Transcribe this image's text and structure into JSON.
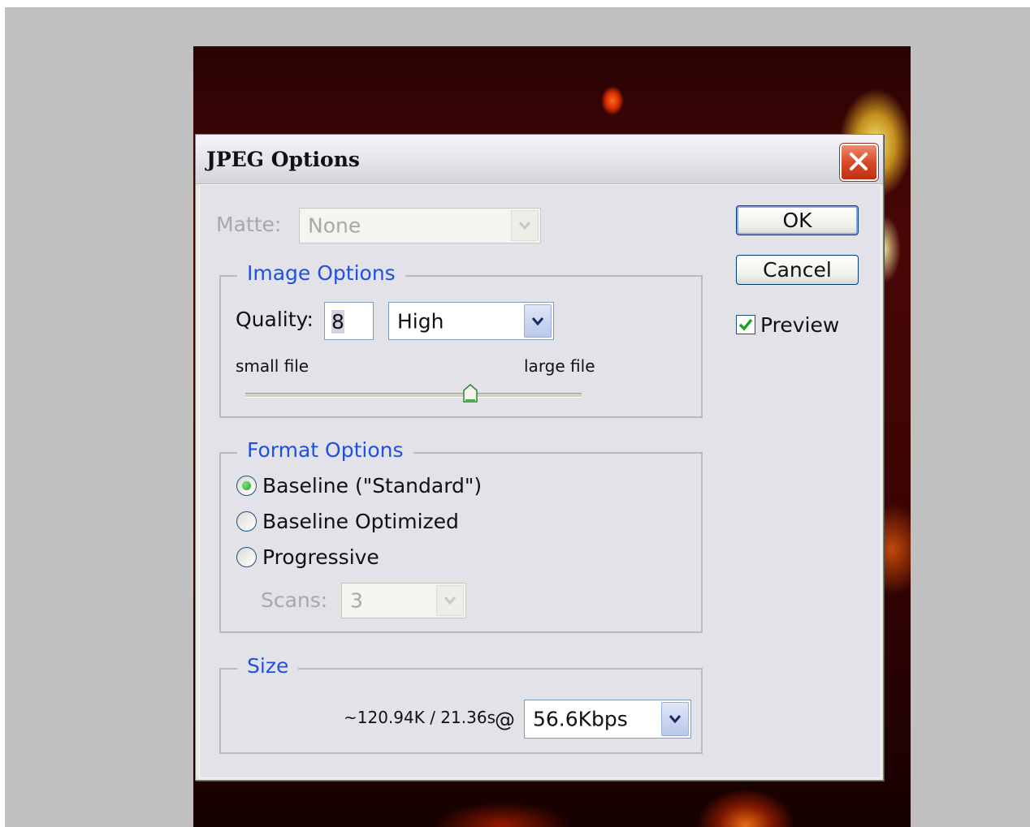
{
  "dialog": {
    "title": "JPEG Options",
    "close_label": "close"
  },
  "matte": {
    "label": "Matte:",
    "value": "None",
    "enabled": false
  },
  "image_options": {
    "title": "Image Options",
    "quality_label": "Quality:",
    "quality_value": "8",
    "quality_preset": "High",
    "small_label": "small file",
    "large_label": "large file",
    "slider_level": 0.67
  },
  "format_options": {
    "title": "Format Options",
    "options": [
      {
        "label": "Baseline (\"Standard\")",
        "selected": true
      },
      {
        "label": "Baseline Optimized",
        "selected": false
      },
      {
        "label": "Progressive",
        "selected": false
      }
    ],
    "scans_label": "Scans:",
    "scans_value": "3"
  },
  "size": {
    "title": "Size",
    "estimate": "~120.94K / 21.36s",
    "at": "@",
    "speed": "56.6Kbps"
  },
  "buttons": {
    "ok": "OK",
    "cancel": "Cancel"
  },
  "preview": {
    "label": "Preview",
    "checked": true
  },
  "colors": {
    "group_title": "#2050e0",
    "check": "#21a121",
    "close_red": "#d84a2a"
  }
}
